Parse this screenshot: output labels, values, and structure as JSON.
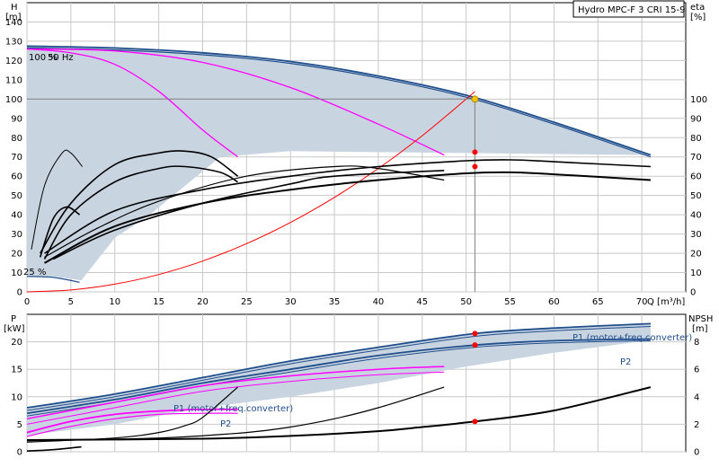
{
  "chart_data": {
    "type": "line",
    "title": "Hydro MPC-F 3 CRI 15-9",
    "operating_point": {
      "q": 51,
      "h": 100,
      "eta": 72.5,
      "eta2": 65,
      "p1": 21.5,
      "p2": 19.4,
      "npsh": 2.2
    },
    "top": {
      "y_left_label": "H",
      "y_left_unit": "[m]",
      "y_right_label": "eta",
      "y_right_unit": "[%]",
      "x_label": "Q [m³/h]",
      "xlim": [
        0,
        75
      ],
      "ylim": [
        0,
        150
      ],
      "x_ticks": [
        "0",
        "5",
        "10",
        "15",
        "20",
        "25",
        "30",
        "35",
        "40",
        "45",
        "50",
        "55",
        "60",
        "65",
        "70"
      ],
      "y_ticks": [
        "0",
        "10",
        "20",
        "30",
        "40",
        "50",
        "60",
        "70",
        "80",
        "90",
        "100",
        "110",
        "120",
        "130",
        "140"
      ],
      "y_right_ticks": [
        "0",
        "10",
        "20",
        "30",
        "40",
        "50",
        "60",
        "70",
        "80",
        "90",
        "100"
      ],
      "annotations": {
        "speed_top": "100 %",
        "freq": "50 Hz",
        "speed_bottom": "25 %"
      },
      "series": [
        {
          "role": "head-max-outer",
          "color": "#1f4e8c",
          "width": 1.8,
          "x": [
            0,
            10,
            20,
            30,
            40,
            50,
            60,
            71
          ],
          "y": [
            127.5,
            126.5,
            124,
            119.5,
            112,
            102,
            88,
            71
          ]
        },
        {
          "role": "head-max-inner",
          "color": "#1f4e8c",
          "width": 1.2,
          "x": [
            0,
            10,
            20,
            30,
            40,
            50,
            60,
            71
          ],
          "y": [
            126.5,
            125.5,
            123,
            118.5,
            111,
            101,
            87,
            70
          ]
        },
        {
          "role": "head-1pump",
          "color": "#ff00ff",
          "width": 1.3,
          "x": [
            0,
            5,
            10,
            15,
            20,
            24
          ],
          "y": [
            126,
            124,
            118,
            104,
            84,
            70
          ]
        },
        {
          "role": "head-2pumps",
          "color": "#ff00ff",
          "width": 1.3,
          "x": [
            0,
            10,
            20,
            30,
            40,
            47.5
          ],
          "y": [
            126,
            125,
            119,
            106,
            87,
            71
          ]
        },
        {
          "role": "min-speed-head",
          "color": "#1f4e8c",
          "width": 1.2,
          "x": [
            0,
            3,
            6
          ],
          "y": [
            8,
            7.5,
            5
          ]
        },
        {
          "role": "system-curve",
          "color": "#ff0000",
          "width": 1,
          "x": [
            0,
            5,
            10,
            15,
            20,
            25,
            30,
            35,
            40,
            45,
            50,
            51
          ],
          "y": [
            0,
            1,
            4,
            9,
            16,
            25,
            36,
            49,
            64,
            81,
            100,
            104
          ]
        },
        {
          "role": "op-line-h",
          "color": "#808080",
          "width": 1,
          "x": [
            0,
            51
          ],
          "y": [
            100,
            100
          ]
        },
        {
          "role": "op-line-v",
          "color": "#808080",
          "width": 1,
          "x": [
            51,
            51
          ],
          "y": [
            0,
            100
          ]
        },
        {
          "role": "eta-3pumps-a",
          "color": "#000000",
          "width": 1.6,
          "x": [
            2,
            10,
            20,
            30,
            40,
            50,
            55,
            60,
            71
          ],
          "y": [
            20,
            42,
            53,
            60,
            65,
            68,
            68.5,
            67.5,
            65
          ]
        },
        {
          "role": "eta-3pumps-b",
          "color": "#000000",
          "width": 2,
          "x": [
            2,
            10,
            20,
            30,
            40,
            50,
            55,
            60,
            71
          ],
          "y": [
            15,
            34,
            46,
            53,
            58,
            61.5,
            62,
            61,
            58
          ]
        },
        {
          "role": "eta-2pumps-a",
          "color": "#000000",
          "width": 1.2,
          "x": [
            2,
            8,
            15,
            25,
            35,
            40,
            47.5
          ],
          "y": [
            18,
            33,
            47,
            60,
            65,
            64,
            58
          ]
        },
        {
          "role": "eta-2pumps-b",
          "color": "#000000",
          "width": 1.6,
          "x": [
            3,
            10,
            20,
            30,
            35,
            47.5
          ],
          "y": [
            17,
            32,
            46,
            56,
            60,
            63
          ]
        },
        {
          "role": "eta-1pump-a",
          "color": "#000000",
          "width": 1.6,
          "x": [
            1.5,
            5,
            10,
            15,
            18,
            21,
            24
          ],
          "y": [
            20,
            46,
            66,
            72,
            73,
            70,
            60
          ]
        },
        {
          "role": "eta-1pump-b",
          "color": "#000000",
          "width": 1.6,
          "x": [
            2,
            5,
            10,
            15,
            18,
            22,
            24
          ],
          "y": [
            17,
            40,
            57,
            64,
            65,
            62,
            57
          ]
        },
        {
          "role": "eta-small-a",
          "color": "#000000",
          "width": 1,
          "x": [
            0.5,
            2,
            4,
            5,
            6.3
          ],
          "y": [
            22,
            55,
            72,
            72,
            65
          ]
        },
        {
          "role": "eta-small-b",
          "color": "#000000",
          "width": 1.6,
          "x": [
            1.5,
            3,
            4.5,
            6
          ],
          "y": [
            18,
            38,
            44,
            40
          ]
        }
      ],
      "points": [
        {
          "q": 51,
          "v": 100,
          "color": "#f5c400",
          "r": 3.5
        },
        {
          "q": 51,
          "v": 72.5,
          "color": "#ff0000",
          "r": 3
        },
        {
          "q": 51,
          "v": 65,
          "color": "#ff0000",
          "r": 3
        }
      ],
      "legend_text": "Hydro MPC-F 3 CRI 15-9"
    },
    "bottom": {
      "y_left_label": "P",
      "y_left_unit": "[kW]",
      "y_right_label": "NPSH",
      "y_right_unit": "[m]",
      "xlim": [
        0,
        75
      ],
      "ylim": [
        0,
        25
      ],
      "y_right_lim": [
        0,
        10
      ],
      "y_ticks": [
        "0",
        "5",
        "10",
        "15",
        "20"
      ],
      "y_right_ticks": [
        "0",
        "2",
        "4",
        "6",
        "8"
      ],
      "labels": {
        "p1_main": "P1 (motor+freq.converter)",
        "p2_main": "P2",
        "p1_small": "P1 (motor+freq.converter)",
        "p2_small": "P2"
      },
      "series": [
        {
          "role": "p1-outer",
          "color": "#1f4e8c",
          "width": 1.8,
          "x": [
            0,
            10,
            20,
            30,
            40,
            51,
            60,
            71
          ],
          "y": [
            8,
            10.5,
            13.5,
            16.5,
            19,
            21.5,
            22.5,
            23.3
          ]
        },
        {
          "role": "p1-inner",
          "color": "#1f4e8c",
          "width": 1,
          "x": [
            0,
            10,
            20,
            30,
            40,
            51,
            60,
            71
          ],
          "y": [
            7.5,
            10,
            13,
            16,
            18.5,
            21,
            22,
            22.8
          ]
        },
        {
          "role": "p2-outer",
          "color": "#1f4e8c",
          "width": 1.8,
          "x": [
            0,
            10,
            20,
            30,
            40,
            51,
            60,
            71
          ],
          "y": [
            7,
            9.5,
            12.5,
            15,
            17.5,
            19.4,
            20.2,
            20.5
          ]
        },
        {
          "role": "p2-inner",
          "color": "#1f4e8c",
          "width": 1,
          "x": [
            0,
            10,
            20,
            30,
            40,
            51,
            60,
            71
          ],
          "y": [
            6.5,
            9,
            12,
            14.5,
            17,
            19,
            19.8,
            20.2
          ]
        },
        {
          "role": "p-2pumps-a",
          "color": "#ff00ff",
          "width": 1.5,
          "x": [
            0,
            10,
            20,
            30,
            40,
            47.5
          ],
          "y": [
            6,
            9,
            12,
            13.8,
            15,
            15.5
          ]
        },
        {
          "role": "p-2pumps-b",
          "color": "#ff00ff",
          "width": 1,
          "x": [
            0,
            10,
            20,
            30,
            40,
            47.5
          ],
          "y": [
            5,
            8,
            11,
            12.8,
            14,
            14.5
          ]
        },
        {
          "role": "p-1pump-a",
          "color": "#ff00ff",
          "width": 1.8,
          "x": [
            0,
            5,
            10,
            15,
            20,
            24
          ],
          "y": [
            3.5,
            5.5,
            6.8,
            7.4,
            7.7,
            7.7
          ]
        },
        {
          "role": "p-1pump-b",
          "color": "#ff00ff",
          "width": 1.2,
          "x": [
            0,
            5,
            10,
            15,
            20,
            24
          ],
          "y": [
            2.8,
            4.6,
            6,
            6.8,
            7,
            7
          ]
        },
        {
          "role": "npsh-3pumps",
          "color": "#000000",
          "width": 2,
          "x": [
            0,
            20,
            30,
            40,
            45,
            51,
            60,
            71
          ],
          "y": [
            0.85,
            0.95,
            1.15,
            1.5,
            1.8,
            2.2,
            3,
            4.7
          ]
        },
        {
          "role": "npsh-2pumps",
          "color": "#000000",
          "width": 1.2,
          "x": [
            0,
            15,
            25,
            30,
            35,
            40,
            47.5
          ],
          "y": [
            0.8,
            1,
            1.4,
            1.8,
            2.4,
            3.2,
            4.7
          ]
        },
        {
          "role": "npsh-1pump",
          "color": "#000000",
          "width": 1.2,
          "x": [
            0,
            10,
            15,
            18,
            20,
            24
          ],
          "y": [
            0.7,
            1,
            1.4,
            1.9,
            2.5,
            4.7
          ]
        },
        {
          "role": "npsh-small",
          "color": "#000000",
          "width": 1.6,
          "x": [
            0,
            3,
            6.2
          ],
          "y": [
            0.05,
            0.15,
            0.35
          ]
        }
      ],
      "points": [
        {
          "q": 51,
          "v": 21.5,
          "color": "#ff0000",
          "r": 3
        },
        {
          "q": 51,
          "v": 19.4,
          "color": "#ff0000",
          "r": 3
        },
        {
          "q": 51,
          "v": 5.5,
          "color": "#ff0000",
          "r": 3
        }
      ]
    }
  }
}
